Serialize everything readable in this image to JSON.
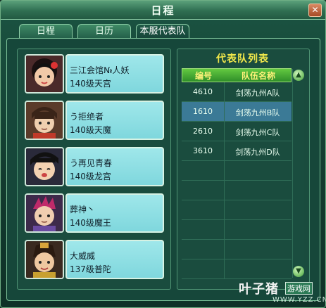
{
  "window": {
    "title": "日程",
    "close_label": "✕"
  },
  "tabs": [
    {
      "label": "日程",
      "active": false
    },
    {
      "label": "日历",
      "active": false
    },
    {
      "label": "本服代表队",
      "active": true
    }
  ],
  "members": [
    {
      "name": "三江会馆№人妖",
      "level": "140级天宫"
    },
    {
      "name": "う拒绝者",
      "level": "140级天魔"
    },
    {
      "name": "う再见青春",
      "level": "140级龙宫"
    },
    {
      "name": "葬神丶",
      "level": "140级魔王"
    },
    {
      "name": "大威威",
      "level": "137级普陀"
    }
  ],
  "team_list": {
    "title": "代表队列表",
    "columns": [
      "编号",
      "队伍名称"
    ],
    "rows": [
      {
        "id": "4610",
        "name": "剑荡九州A队",
        "selected": false
      },
      {
        "id": "1610",
        "name": "剑荡九州B队",
        "selected": true
      },
      {
        "id": "2610",
        "name": "剑荡九州C队",
        "selected": false
      },
      {
        "id": "3610",
        "name": "剑荡九州D队",
        "selected": false
      }
    ]
  },
  "watermark": {
    "logo": "叶子猪",
    "badge": "游戏网",
    "url": "WWW.YZZ.CN"
  }
}
